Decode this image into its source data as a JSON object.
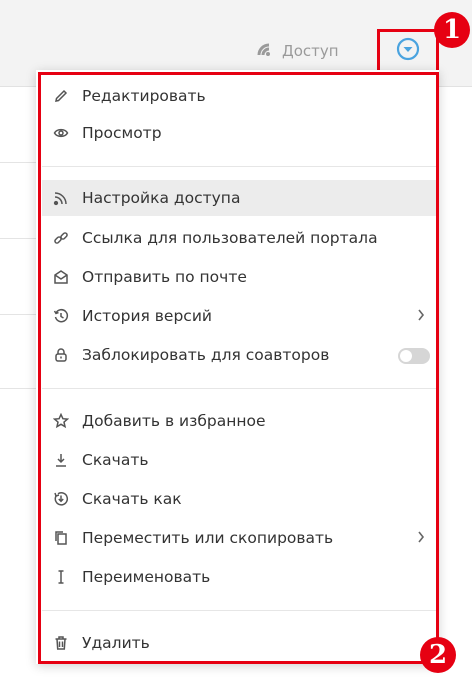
{
  "header": {
    "access_label": "Доступ",
    "access_icon": "rss-icon",
    "dropdown_icon": "chevron-down-circle-icon",
    "accent_color": "#4aa3df"
  },
  "annotations": {
    "badge_1": "1",
    "badge_2": "2",
    "highlight_color": "#e60012"
  },
  "menu": {
    "items": [
      {
        "label": "Редактировать",
        "icon": "pencil-icon"
      },
      {
        "label": "Просмотр",
        "icon": "eye-icon"
      },
      {
        "label": "Настройка доступа",
        "icon": "rss-icon",
        "active": true
      },
      {
        "label": "Ссылка для пользователей портала",
        "icon": "link-icon"
      },
      {
        "label": "Отправить по почте",
        "icon": "envelope-icon"
      },
      {
        "label": "История версий",
        "icon": "history-icon",
        "submenu": true
      },
      {
        "label": "Заблокировать для соавторов",
        "icon": "lock-icon",
        "toggle": false
      },
      {
        "label": "Добавить в избранное",
        "icon": "star-icon"
      },
      {
        "label": "Скачать",
        "icon": "download-icon"
      },
      {
        "label": "Скачать как",
        "icon": "download-as-icon"
      },
      {
        "label": "Переместить или скопировать",
        "icon": "copy-icon",
        "submenu": true
      },
      {
        "label": "Переименовать",
        "icon": "text-cursor-icon"
      },
      {
        "label": "Удалить",
        "icon": "trash-icon"
      }
    ]
  }
}
